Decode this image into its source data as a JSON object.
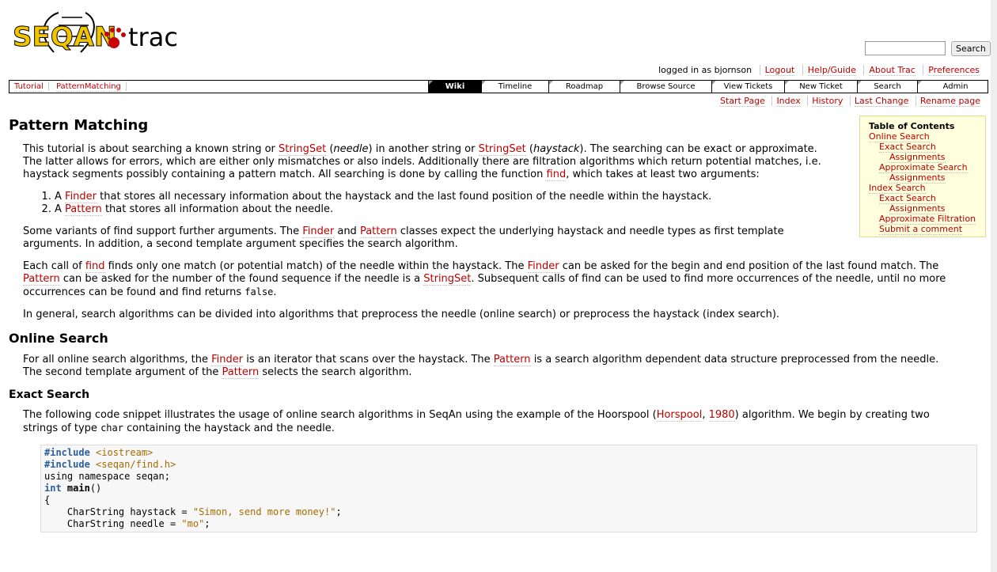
{
  "logo": {
    "text_seqan": "SEQAN",
    "text_trac": "trac"
  },
  "search": {
    "placeholder": "",
    "button": "Search"
  },
  "metanav": {
    "user_text": "logged in as bjornson",
    "items": [
      "Logout",
      "Help/Guide",
      "About Trac",
      "Preferences"
    ]
  },
  "ctxnav": {
    "items": [
      "Tutorial",
      "PatternMatching"
    ]
  },
  "mainnav": {
    "tabs": [
      "Wiki",
      "Timeline",
      "Roadmap",
      "Browse Source",
      "View Tickets",
      "New Ticket",
      "Search",
      "Admin"
    ],
    "active": "Wiki"
  },
  "ctxlinks": {
    "items": [
      "Start Page",
      "Index",
      "History",
      "Last Change",
      "Rename page"
    ]
  },
  "toc": {
    "title": "Table of Contents",
    "items": [
      "Online Search",
      "Exact Search",
      "Assignments",
      "Approximate Search",
      "Assignments",
      "Index Search",
      "Exact Search",
      "Assignments",
      "Approximate Filtration",
      "Submit a comment"
    ]
  },
  "page": {
    "title": "Pattern Matching",
    "intro": {
      "t1": "This tutorial is about searching a known string or ",
      "link1": "StringSet",
      "t2": " (",
      "em1": "needle",
      "t3": ") in another string or ",
      "link2": "StringSet",
      "t4": " (",
      "em2": "haystack",
      "t5": "). The searching can be exact or approximate. The latter allows for errors, which are either only mismatches or also indels. Additionally there are filtration algorithms which return potential matches, i.e. haystack segments possibly containing a pattern match. All searching is done by calling the function ",
      "link3": "find",
      "t6": ", which takes at least two arguments:"
    },
    "list": [
      {
        "pre": "A ",
        "link": "Finder",
        "post": " that stores all necessary information about the haystack and the last found position of the needle within the haystack."
      },
      {
        "pre": "A ",
        "link": "Pattern",
        "post": " that stores all information about the needle."
      }
    ],
    "p2": {
      "t1": "Some variants of find support further arguments. The ",
      "l1": "Finder",
      "t2": " and ",
      "l2": "Pattern",
      "t3": " classes expect the underlying haystack and needle types as first template arguments. In addition, a second template argument specifies the search algorithm."
    },
    "p3": {
      "t1": "Each call of ",
      "l1": "find",
      "t2": " finds only one match (or potential match) of the needle within the haystack. The ",
      "l2": "Finder",
      "t3": " can be asked for the begin and end position of the last found match. The ",
      "l3": "Pattern",
      "t4": " can be asked for the number of the found sequence if the needle is a ",
      "l4": "StringSet",
      "t5": ". Subsequent calls of find can be used to find more occurrences of the needle, until no more occurrences can be found and find returns ",
      "code": "false",
      "t6": "."
    },
    "p4": "In general, search algorithms can be divided into algorithms that preprocess the needle (online search) or preprocess the haystack (index search).",
    "h_online": "Online Search",
    "p5": {
      "t1": "For all online search algorithms, the ",
      "l1": "Finder",
      "t2": " is an iterator that scans over the haystack. The ",
      "l2": "Pattern",
      "t3": " is a search algorithm dependent data structure preprocessed from the needle. The second template argument of the ",
      "l3": "Pattern",
      "t4": " selects the search algorithm."
    },
    "h_exact": "Exact Search",
    "p6": {
      "t1": "The following code snippet illustrates the usage of online search algorithms in SeqAn using the example of the Hoorspool (",
      "l1": "Horspool",
      "t2": ", ",
      "l2": "1980",
      "t3": ") algorithm. We begin by creating two strings of type ",
      "code": "char",
      "t4": " containing the haystack and the needle."
    }
  },
  "code": {
    "l1_pp": "#include",
    "l1_str": "<iostream>",
    "l2_pp": "#include",
    "l2_str": "<seqan/find.h>",
    "l3": "using namespace seqan;",
    "l4_kw": "int",
    "l4_fn": "main",
    "l4_rest": "()",
    "l5": "{",
    "l6_a": "    CharString haystack = ",
    "l6_str": "\"Simon, send more money!\"",
    "l6_b": ";",
    "l7_a": "    CharString needle = ",
    "l7_str": "\"mo\"",
    "l7_b": ";"
  }
}
